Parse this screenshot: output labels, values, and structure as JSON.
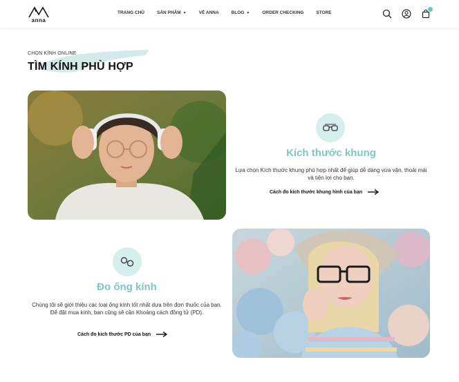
{
  "header": {
    "logo_text": "anna",
    "nav": [
      {
        "label": "TRANG CHỦ",
        "dropdown": false
      },
      {
        "label": "SẢN PHẨM",
        "dropdown": true
      },
      {
        "label": "VỀ ANNA",
        "dropdown": false
      },
      {
        "label": "BLOG",
        "dropdown": true
      },
      {
        "label": "ORDER CHECKING",
        "dropdown": false
      },
      {
        "label": "STORE",
        "dropdown": false
      }
    ],
    "icons": [
      "search-icon",
      "user-icon",
      "cart-icon"
    ],
    "accent_color": "#6cc6c0"
  },
  "section": {
    "eyebrow": "CHỌN KÍNH ONLINE",
    "title": "TÌM KÍNH PHÙ HỢP"
  },
  "features": [
    {
      "icon": "glasses-frame-icon",
      "title": "Kích thước khung",
      "description": "Lựa chọn Kích thước khung phù hợp nhất để giúp dễ dàng vừa vặn, thoải mái và tiện lợi cho bạn.",
      "link": "Cách đo kích thước khung hình của bạn"
    },
    {
      "icon": "lens-icon",
      "title": "Đo ống kính",
      "description": "Chúng tôi sẽ giới thiệu các loại ống kính tốt nhất dựa trên đơn thuốc của bạn. Để đặt mua kính, bạn cũng sẽ cần Khoảng cách đồng tử (PD).",
      "link": "Cách đo kích thước PD của bạn"
    }
  ],
  "colors": {
    "title_teal": "#7dc7c2",
    "icon_bg": "#d5efed",
    "brush": "#cfe8e6"
  }
}
